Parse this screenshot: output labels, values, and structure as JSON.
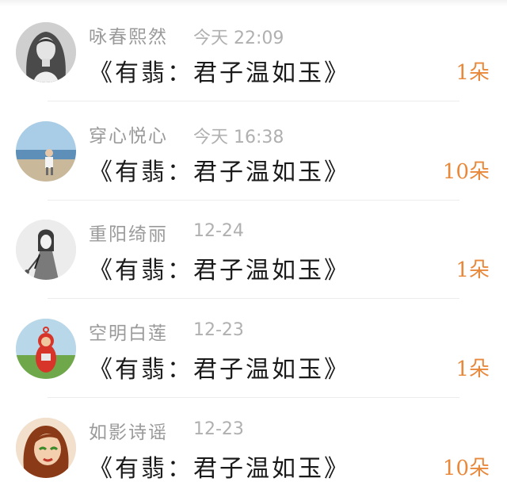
{
  "colors": {
    "accent": "#e8883a",
    "username": "#9a9a9a",
    "timestamp": "#b0b0b0",
    "title": "#1a1a1a"
  },
  "entries": [
    {
      "username": "咏春熙然",
      "time": "今天 22:09",
      "title": "《有翡：君子温如玉》",
      "count": "1朵",
      "avatar_icon": "avatar-woman-bw"
    },
    {
      "username": "穿心悦心",
      "time": "今天 16:38",
      "title": "《有翡：君子温如玉》",
      "count": "10朵",
      "avatar_icon": "avatar-beach"
    },
    {
      "username": "重阳绮丽",
      "time": "12-24",
      "title": "《有翡：君子温如玉》",
      "count": "1朵",
      "avatar_icon": "avatar-sketch"
    },
    {
      "username": "空明白莲",
      "time": "12-23",
      "title": "《有翡：君子温如玉》",
      "count": "1朵",
      "avatar_icon": "avatar-teletubby"
    },
    {
      "username": "如影诗谣",
      "time": "12-23",
      "title": "《有翡：君子温如玉》",
      "count": "10朵",
      "avatar_icon": "avatar-cartoon-woman"
    }
  ]
}
